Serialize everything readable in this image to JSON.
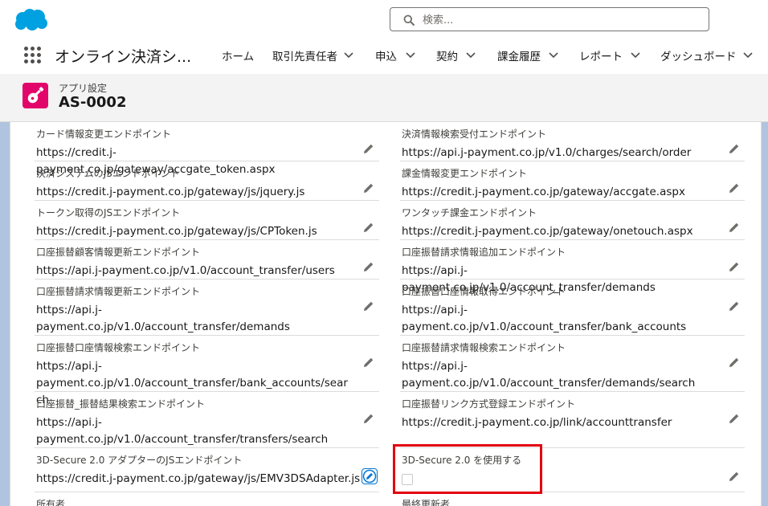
{
  "global_header": {
    "search_placeholder": "検索...",
    "app_name": "オンライン決済シ...",
    "nav": [
      {
        "label": "ホーム",
        "has_menu": false
      },
      {
        "label": "取引先責任者",
        "has_menu": true
      },
      {
        "label": "申込",
        "has_menu": true
      },
      {
        "label": "契約",
        "has_menu": true
      },
      {
        "label": "課金履歴",
        "has_menu": true
      },
      {
        "label": "レポート",
        "has_menu": true
      },
      {
        "label": "ダッシュボード",
        "has_menu": true
      }
    ]
  },
  "record": {
    "object_label": "アプリ設定",
    "name": "AS-0002",
    "icon": "guitar-icon",
    "icon_color": "#e3066a"
  },
  "fields": {
    "left": [
      {
        "label": "カード情報変更エンドポイント",
        "value": "https://credit.j-payment.co.jp/gateway/accgate_token.aspx"
      },
      {
        "label": "決済システムのJSエンドポイント",
        "value": "https://credit.j-payment.co.jp/gateway/js/jquery.js"
      },
      {
        "label": "トークン取得のJSエンドポイント",
        "value": "https://credit.j-payment.co.jp/gateway/js/CPToken.js"
      },
      {
        "label": "口座振替顧客情報更新エンドポイント",
        "value": "https://api.j-payment.co.jp/v1.0/account_transfer/users"
      },
      {
        "label": "口座振替請求情報更新エンドポイント",
        "value": "https://api.j-payment.co.jp/v1.0/account_transfer/demands"
      },
      {
        "label": "口座振替口座情報検索エンドポイント",
        "value": "https://api.j-payment.co.jp/v1.0/account_transfer/bank_accounts/search"
      },
      {
        "label": "口座振替_振替結果検索エンドポイント",
        "value": "https://api.j-payment.co.jp/v1.0/account_transfer/transfers/search"
      },
      {
        "label": "3D-Secure 2.0 アダプターのJSエンドポイント",
        "value": "https://credit.j-payment.co.jp/gateway/js/EMV3DSAdapter.js"
      },
      {
        "label": "所有者",
        "value": ""
      }
    ],
    "right": [
      {
        "label": "決済情報検索受付エンドポイント",
        "value": "https://api.j-payment.co.jp/v1.0/charges/search/order"
      },
      {
        "label": "課金情報変更エンドポイント",
        "value": "https://credit.j-payment.co.jp/gateway/accgate.aspx"
      },
      {
        "label": "ワンタッチ課金エンドポイント",
        "value": "https://credit.j-payment.co.jp/gateway/onetouch.aspx"
      },
      {
        "label": "口座振替請求情報追加エンドポイント",
        "value": "https://api.j-payment.co.jp/v1.0/account_transfer/demands"
      },
      {
        "label": "口座振替口座情報取得エンドポイント",
        "value": "https://api.j-payment.co.jp/v1.0/account_transfer/bank_accounts"
      },
      {
        "label": "口座振替請求情報検索エンドポイント",
        "value": "https://api.j-payment.co.jp/v1.0/account_transfer/demands/search"
      },
      {
        "label": "口座振替リンク方式登録エンドポイント",
        "value": "https://credit.j-payment.co.jp/link/accounttransfer"
      },
      {
        "label": "3D-Secure 2.0 を使用する",
        "checked": false
      },
      {
        "label": "最終更新者",
        "value": ""
      }
    ]
  },
  "colors": {
    "brand_blue": "#00a1e0",
    "highlight_red": "#e3000f",
    "focus_blue": "#0176d3"
  }
}
